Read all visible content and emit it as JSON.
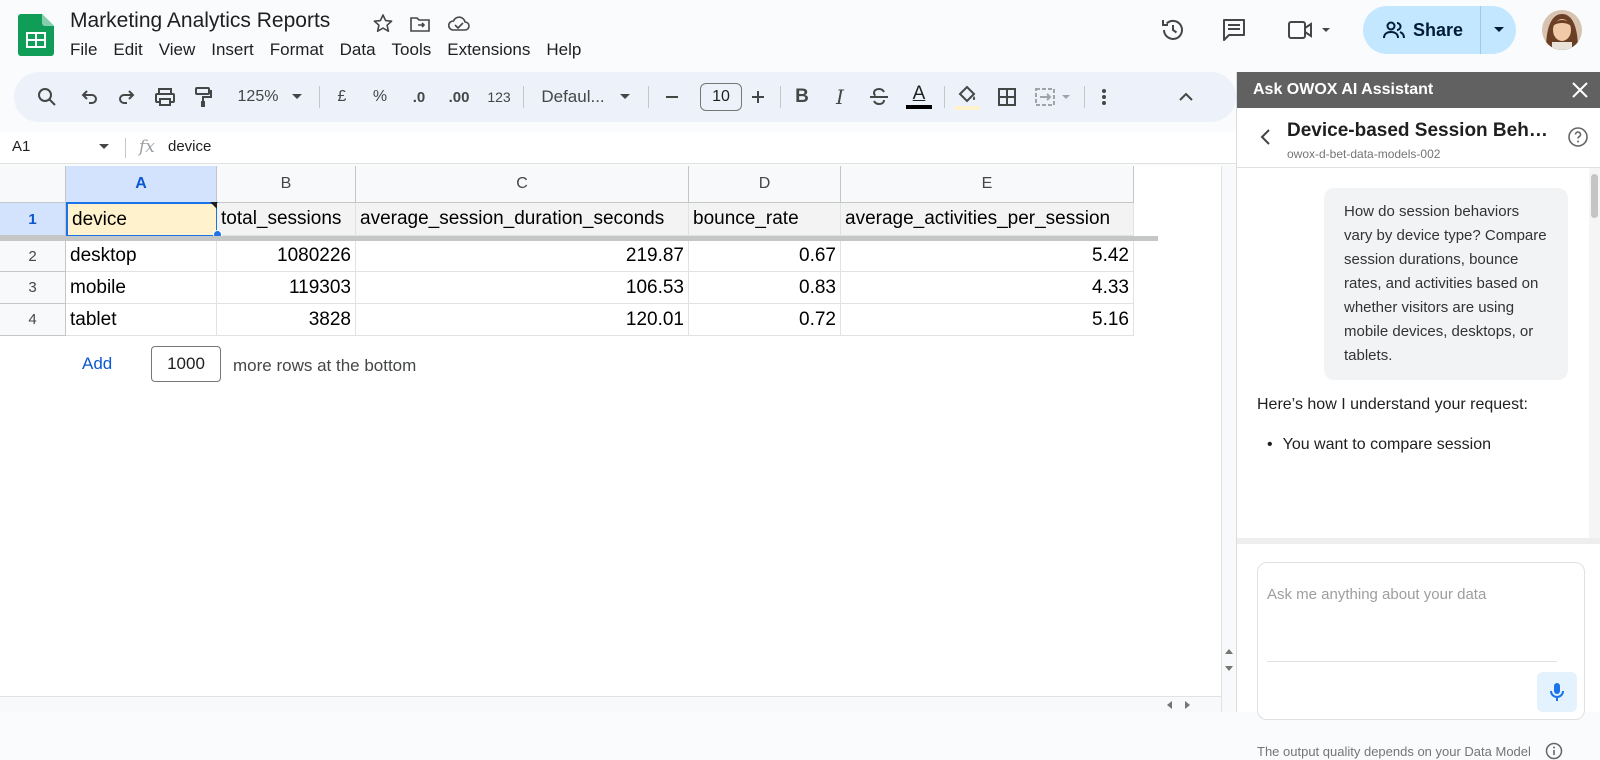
{
  "app": {
    "title": "Marketing Analytics Reports",
    "menu": [
      "File",
      "Edit",
      "View",
      "Insert",
      "Format",
      "Data",
      "Tools",
      "Extensions",
      "Help"
    ],
    "share_label": "Share"
  },
  "toolbar": {
    "zoom": "125%",
    "currency": "£",
    "percent": "%",
    "decrease_decimal": ".0",
    "increase_decimal": ".00",
    "number_format": "123",
    "font": "Defaul...",
    "font_size": "10",
    "bold": "B",
    "italic": "I",
    "text_color": "A"
  },
  "formula_bar": {
    "cell_ref": "A1",
    "fx": "fx",
    "value": "device"
  },
  "sheet": {
    "columns": [
      "A",
      "B",
      "C",
      "D",
      "E"
    ],
    "rows": [
      "1",
      "2",
      "3",
      "4"
    ],
    "header": [
      "device",
      "total_sessions",
      "average_session_duration_seconds",
      "bounce_rate",
      "average_activities_per_session"
    ],
    "data": [
      [
        "desktop",
        "1080226",
        "219.87",
        "0.67",
        "5.42"
      ],
      [
        "mobile",
        "119303",
        "106.53",
        "0.83",
        "4.33"
      ],
      [
        "tablet",
        "3828",
        "120.01",
        "0.72",
        "5.16"
      ]
    ],
    "add_label": "Add",
    "add_rows_value": "1000",
    "add_rows_text": "more rows at the bottom"
  },
  "assistant": {
    "header": "Ask OWOX AI Assistant",
    "report_title": "Device-based Session Behav...",
    "report_subtitle": "owox-d-bet-data-models-002",
    "user_message": "How do session behaviors vary by device type? Compare session durations, bounce rates, and activities based on whether visitors are using mobile devices, desktops, or tablets.",
    "reply_intro": "Here’s how I understand your request:",
    "reply_bullet": "You want to compare session",
    "input_placeholder": "Ask me anything about your data",
    "footer_note": "The output quality depends on your Data Model"
  },
  "colors": {
    "accent": "#0b57d0",
    "share_bg": "#c2e7ff",
    "panel_header": "#616161",
    "selected_cell": "#fff2cc"
  }
}
